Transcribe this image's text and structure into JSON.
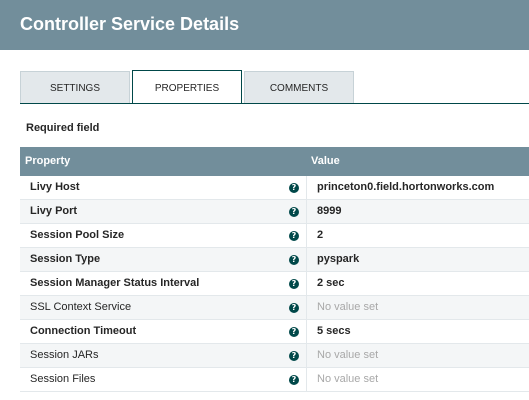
{
  "dialog": {
    "title": "Controller Service Details"
  },
  "tabs": [
    {
      "label": "SETTINGS",
      "active": false
    },
    {
      "label": "PROPERTIES",
      "active": true
    },
    {
      "label": "COMMENTS",
      "active": false
    }
  ],
  "required_label": "Required field",
  "table": {
    "headers": {
      "property": "Property",
      "value": "Value"
    },
    "rows": [
      {
        "name": "Livy Host",
        "value": "princeton0.field.hortonworks.com",
        "required": true,
        "is_set": true
      },
      {
        "name": "Livy Port",
        "value": "8999",
        "required": true,
        "is_set": true
      },
      {
        "name": "Session Pool Size",
        "value": "2",
        "required": true,
        "is_set": true
      },
      {
        "name": "Session Type",
        "value": "pyspark",
        "required": true,
        "is_set": true
      },
      {
        "name": "Session Manager Status Interval",
        "value": "2 sec",
        "required": true,
        "is_set": true
      },
      {
        "name": "SSL Context Service",
        "value": "No value set",
        "required": false,
        "is_set": false
      },
      {
        "name": "Connection Timeout",
        "value": "5 secs",
        "required": true,
        "is_set": true
      },
      {
        "name": "Session JARs",
        "value": "No value set",
        "required": false,
        "is_set": false
      },
      {
        "name": "Session Files",
        "value": "No value set",
        "required": false,
        "is_set": false
      }
    ],
    "help_icon": "help-circle-icon"
  },
  "colors": {
    "header_bg": "#728e9b",
    "accent": "#004849",
    "tab_inactive_bg": "#e3e8eb",
    "unset_value": "#a8a8a8"
  }
}
